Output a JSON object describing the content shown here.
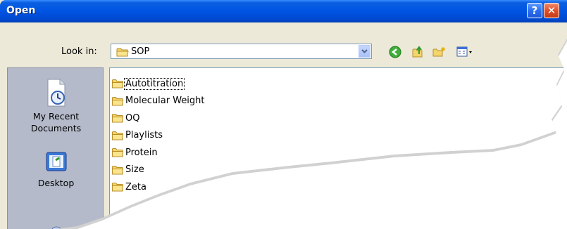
{
  "window": {
    "title": "Open"
  },
  "titlebar": {
    "help_label": "?",
    "close_label": "✕"
  },
  "lookin": {
    "label": "Look in:",
    "value": "SOP"
  },
  "toolbar": {
    "icons": [
      "back-icon",
      "up-folder-icon",
      "new-folder-icon",
      "views-menu-icon"
    ]
  },
  "places": [
    {
      "label": "My Recent\nDocuments",
      "icon": "recent-documents-icon"
    },
    {
      "label": "Desktop",
      "icon": "desktop-icon"
    }
  ],
  "files": [
    {
      "name": "Autotitration",
      "focused": true
    },
    {
      "name": "Molecular Weight"
    },
    {
      "name": "OQ"
    },
    {
      "name": "Playlists"
    },
    {
      "name": "Protein"
    },
    {
      "name": "Size"
    },
    {
      "name": "Zeta"
    }
  ],
  "colors": {
    "title_bar": "#0054E3",
    "places_bar": "#B4BAC9",
    "dialog_bg": "#ECE9D8",
    "folder": "#F5D56B"
  }
}
